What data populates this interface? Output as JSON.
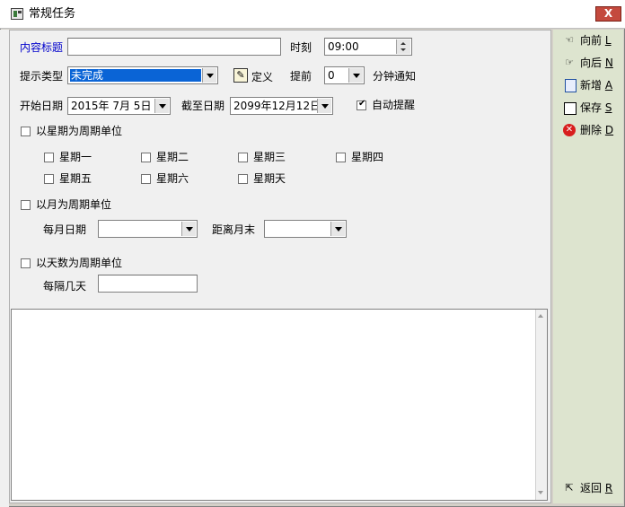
{
  "window": {
    "title": "常规任务",
    "close_label": "X"
  },
  "form": {
    "content_title_label": "内容标题",
    "content_title_value": "",
    "time_label": "时刻",
    "time_value": "09:00",
    "reminder_type_label": "提示类型",
    "reminder_type_value": "未完成",
    "define_label": "定义",
    "advance_label": "提前",
    "advance_value": "0",
    "minutes_notice_label": "分钟通知",
    "start_date_label": "开始日期",
    "start_date_value": "2015年  7月  5日",
    "end_date_label": "截至日期",
    "end_date_value": "2099年12月12日",
    "auto_remind_label": "自动提醒",
    "auto_remind_checked": true,
    "weekly_label": "以星期为周期单位",
    "weekdays": [
      "星期一",
      "星期二",
      "星期三",
      "星期四",
      "星期五",
      "星期六",
      "星期天"
    ],
    "monthly_label": "以月为周期单位",
    "monthly_day_label": "每月日期",
    "monthly_day_value": "",
    "month_end_label": "距离月末",
    "month_end_value": "",
    "daily_label": "以天数为周期单位",
    "every_n_days_label": "每隔几天",
    "every_n_days_value": ""
  },
  "sidebar": {
    "prev": {
      "label": "向前",
      "key": "L",
      "icon": "hand-left-icon"
    },
    "next": {
      "label": "向后",
      "key": "N",
      "icon": "hand-right-icon"
    },
    "add": {
      "label": "新增",
      "key": "A",
      "icon": "new-document-icon"
    },
    "save": {
      "label": "保存",
      "key": "S",
      "icon": "floppy-disk-icon"
    },
    "delete": {
      "label": "删除",
      "key": "D",
      "icon": "delete-red-x-icon"
    },
    "back": {
      "label": "返回",
      "key": "R",
      "icon": "exit-icon"
    }
  }
}
